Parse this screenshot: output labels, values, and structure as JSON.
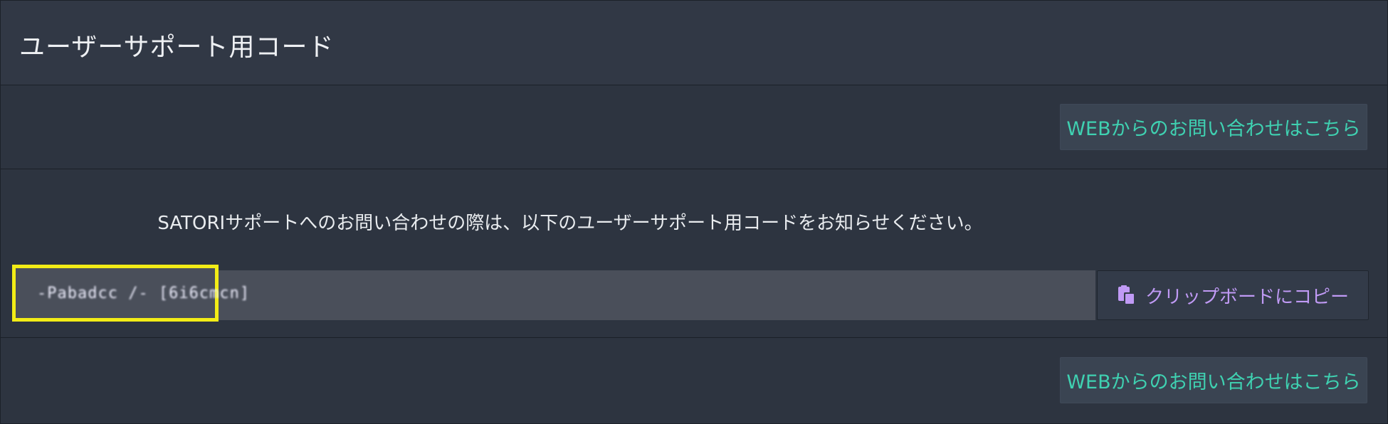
{
  "header": {
    "title": "ユーザーサポート用コード"
  },
  "top_link": {
    "label": "WEBからのお問い合わせはこちら"
  },
  "main": {
    "notice": "SATORIサポートへのお問い合わせの際は、以下のユーザーサポート用コードをお知らせください。",
    "code_value": "-Pabadcc /- [6i6cmcn]",
    "copy_button_label": "クリップボードにコピー",
    "copy_icon": "clipboard-copy-icon"
  },
  "bottom_link": {
    "label": "WEBからのお問い合わせはこちら"
  },
  "colors": {
    "panel_bg": "#2d3440",
    "link_text": "#3fd1b1",
    "copy_text": "#c09af5",
    "highlight": "#f2ec16"
  }
}
